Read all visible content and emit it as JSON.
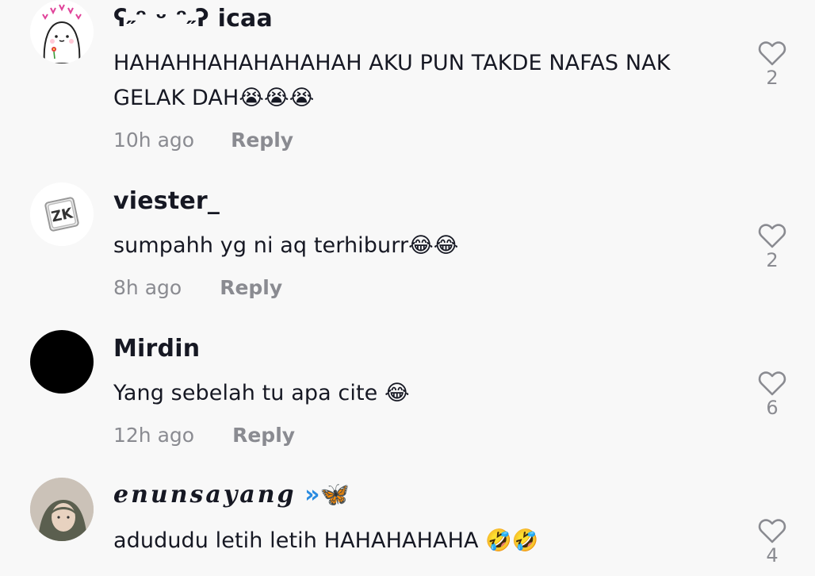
{
  "comments": [
    {
      "username": "ʕ˶ᵔ ᵕ ᵔ˶ʔ icaa",
      "text": "HAHAHHAHAHAHAHAH AKU PUN TAKDE NAFAS NAK GELAK DAH😭😭😭",
      "time": "10h ago",
      "reply": "Reply",
      "likes": "2",
      "avatar": "cartoon-avatar"
    },
    {
      "username": "viester_",
      "text": "sumpahh yg ni aq terhiburr😂😂",
      "time": "8h ago",
      "reply": "Reply",
      "likes": "2",
      "avatar": "zk-logo-avatar"
    },
    {
      "username": "Mirdin",
      "text": "Yang sebelah tu apa cite 😂",
      "time": "12h ago",
      "reply": "Reply",
      "likes": "6",
      "avatar": "black-avatar"
    },
    {
      "username": "enunsayang",
      "username_suffix": "»🦋",
      "text": "adududu letih letih HAHAHAHAHA 🤣🤣",
      "time": "",
      "reply": "",
      "likes": "4",
      "avatar": "photo-avatar"
    }
  ],
  "colors": {
    "background": "#f8f8f8",
    "text": "#161823",
    "muted": "#8a8b91"
  },
  "icons": {
    "like": "heart-outline-icon"
  }
}
